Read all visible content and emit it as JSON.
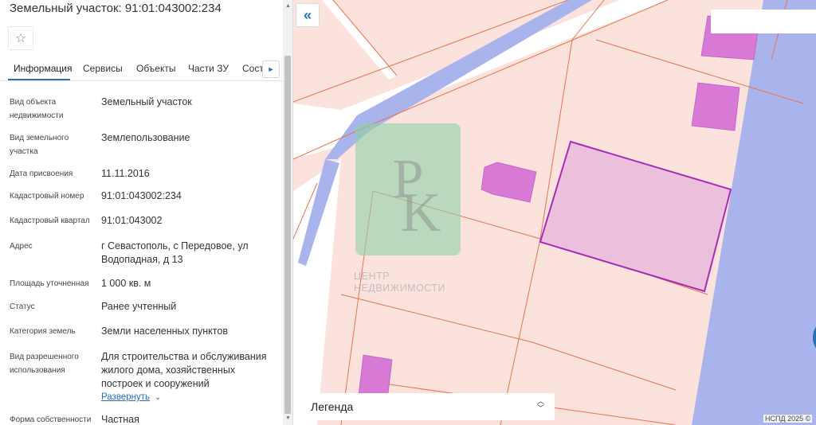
{
  "panel": {
    "title": "Земельный участок: 91:01:043002:234",
    "favorite_icon": "star-outline-icon",
    "tabs": [
      {
        "label": "Информация",
        "active": true
      },
      {
        "label": "Сервисы",
        "active": false
      },
      {
        "label": "Объекты",
        "active": false
      },
      {
        "label": "Части ЗУ",
        "active": false
      },
      {
        "label": "Сост",
        "active": false
      }
    ],
    "tab_next_icon": "chevron-right-icon",
    "rows": [
      {
        "label": "Вид объекта недвижимости",
        "value": "Земельный участок"
      },
      {
        "label": "Вид земельного участка",
        "value": "Землепользование"
      },
      {
        "label": "Дата присвоения",
        "value": "11.11.2016"
      },
      {
        "label": "Кадастровый номер",
        "value": "91:01:043002:234"
      },
      {
        "label": "Кадастровый квартал",
        "value": "91:01:043002"
      },
      {
        "label": "Адрес",
        "value": "г Севастополь, с Передовое, ул Водопадная, д 13"
      },
      {
        "label": "Площадь уточненная",
        "value": "1 000 кв. м"
      },
      {
        "label": "Статус",
        "value": "Ранее учтенный"
      },
      {
        "label": "Категория земель",
        "value": "Земли населенных пунктов"
      },
      {
        "label": "Вид разрешенного использования",
        "value": "Для строительства и обслуживания жилого дома, хозяйственных построек и сооружений"
      },
      {
        "label": "Форма собственности",
        "value": "Частная"
      }
    ],
    "expand_label": "Развернуть"
  },
  "map": {
    "collapse_label": "«",
    "legend_label": "Легенда",
    "watermark_text_line1": "ЦЕНТР",
    "watermark_text_line2": "НЕДВИЖИМОСТИ",
    "copyright": "НСПД 2025 ©",
    "colors": {
      "background": "#fbe2dc",
      "road": "#a9b4ec",
      "parcel_line": "#e8734f",
      "building": "#d879d6",
      "selected_fill": "#ecc0dc",
      "selected_stroke": "#a52db6",
      "watermark": "#8fd3a8"
    }
  }
}
